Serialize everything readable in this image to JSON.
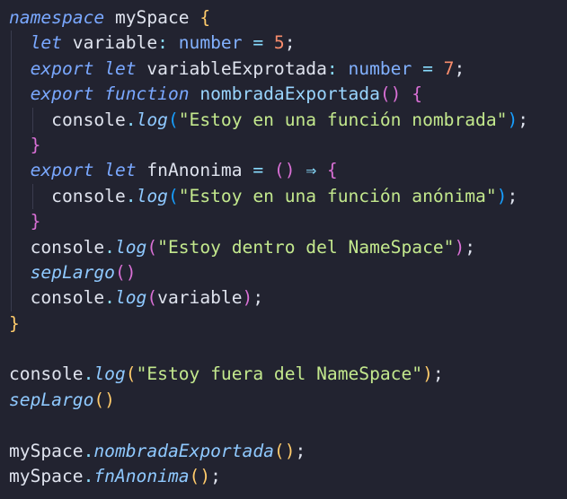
{
  "editor": {
    "lines": [
      [
        {
          "t": "namespace",
          "c": "t-kw"
        },
        {
          "t": " mySpace ",
          "c": "t-plain"
        },
        {
          "t": "{",
          "c": "t-b1"
        }
      ],
      [
        {
          "t": "  ",
          "c": "t-plain"
        },
        {
          "t": "let",
          "c": "t-kw"
        },
        {
          "t": " variable",
          "c": "t-plain"
        },
        {
          "t": ":",
          "c": "t-op"
        },
        {
          "t": " ",
          "c": "t-plain"
        },
        {
          "t": "number",
          "c": "t-type"
        },
        {
          "t": " ",
          "c": "t-plain"
        },
        {
          "t": "=",
          "c": "t-op"
        },
        {
          "t": " ",
          "c": "t-plain"
        },
        {
          "t": "5",
          "c": "t-num"
        },
        {
          "t": ";",
          "c": "t-plain"
        }
      ],
      [
        {
          "t": "  ",
          "c": "t-plain"
        },
        {
          "t": "export",
          "c": "t-kw"
        },
        {
          "t": " ",
          "c": "t-plain"
        },
        {
          "t": "let",
          "c": "t-kw"
        },
        {
          "t": " variableExprotada",
          "c": "t-plain"
        },
        {
          "t": ":",
          "c": "t-op"
        },
        {
          "t": " ",
          "c": "t-plain"
        },
        {
          "t": "number",
          "c": "t-type"
        },
        {
          "t": " ",
          "c": "t-plain"
        },
        {
          "t": "=",
          "c": "t-op"
        },
        {
          "t": " ",
          "c": "t-plain"
        },
        {
          "t": "7",
          "c": "t-num"
        },
        {
          "t": ";",
          "c": "t-plain"
        }
      ],
      [
        {
          "t": "  ",
          "c": "t-plain"
        },
        {
          "t": "export",
          "c": "t-kw"
        },
        {
          "t": " ",
          "c": "t-plain"
        },
        {
          "t": "function",
          "c": "t-kw"
        },
        {
          "t": " ",
          "c": "t-plain"
        },
        {
          "t": "nombradaExportada",
          "c": "t-fnname"
        },
        {
          "t": "()",
          "c": "t-b2"
        },
        {
          "t": " ",
          "c": "t-plain"
        },
        {
          "t": "{",
          "c": "t-b2"
        }
      ],
      [
        {
          "t": "    console",
          "c": "t-plain"
        },
        {
          "t": ".",
          "c": "t-op"
        },
        {
          "t": "log",
          "c": "t-fn-it"
        },
        {
          "t": "(",
          "c": "t-b3"
        },
        {
          "t": "\"Estoy en una función nombrada\"",
          "c": "t-str"
        },
        {
          "t": ")",
          "c": "t-b3"
        },
        {
          "t": ";",
          "c": "t-plain"
        }
      ],
      [
        {
          "t": "  ",
          "c": "t-plain"
        },
        {
          "t": "}",
          "c": "t-b2"
        }
      ],
      [
        {
          "t": "  ",
          "c": "t-plain"
        },
        {
          "t": "export",
          "c": "t-kw"
        },
        {
          "t": " ",
          "c": "t-plain"
        },
        {
          "t": "let",
          "c": "t-kw"
        },
        {
          "t": " fnAnonima ",
          "c": "t-plain"
        },
        {
          "t": "=",
          "c": "t-op"
        },
        {
          "t": " ",
          "c": "t-plain"
        },
        {
          "t": "()",
          "c": "t-b2"
        },
        {
          "t": " ",
          "c": "t-plain"
        },
        {
          "t": "⇒",
          "c": "t-op"
        },
        {
          "t": " ",
          "c": "t-plain"
        },
        {
          "t": "{",
          "c": "t-b2"
        }
      ],
      [
        {
          "t": "    console",
          "c": "t-plain"
        },
        {
          "t": ".",
          "c": "t-op"
        },
        {
          "t": "log",
          "c": "t-fn-it"
        },
        {
          "t": "(",
          "c": "t-b3"
        },
        {
          "t": "\"Estoy en una función anónima\"",
          "c": "t-str"
        },
        {
          "t": ")",
          "c": "t-b3"
        },
        {
          "t": ";",
          "c": "t-plain"
        }
      ],
      [
        {
          "t": "  ",
          "c": "t-plain"
        },
        {
          "t": "}",
          "c": "t-b2"
        }
      ],
      [
        {
          "t": "  console",
          "c": "t-plain"
        },
        {
          "t": ".",
          "c": "t-op"
        },
        {
          "t": "log",
          "c": "t-fn-it"
        },
        {
          "t": "(",
          "c": "t-b2"
        },
        {
          "t": "\"Estoy dentro del NameSpace\"",
          "c": "t-str"
        },
        {
          "t": ")",
          "c": "t-b2"
        },
        {
          "t": ";",
          "c": "t-plain"
        }
      ],
      [
        {
          "t": "  ",
          "c": "t-plain"
        },
        {
          "t": "sepLargo",
          "c": "t-fn-it"
        },
        {
          "t": "()",
          "c": "t-b2"
        }
      ],
      [
        {
          "t": "  console",
          "c": "t-plain"
        },
        {
          "t": ".",
          "c": "t-op"
        },
        {
          "t": "log",
          "c": "t-fn-it"
        },
        {
          "t": "(",
          "c": "t-b2"
        },
        {
          "t": "variable",
          "c": "t-plain"
        },
        {
          "t": ")",
          "c": "t-b2"
        },
        {
          "t": ";",
          "c": "t-plain"
        }
      ],
      [
        {
          "t": "}",
          "c": "t-b1"
        }
      ],
      [],
      [
        {
          "t": "console",
          "c": "t-plain"
        },
        {
          "t": ".",
          "c": "t-op"
        },
        {
          "t": "log",
          "c": "t-fn-it"
        },
        {
          "t": "(",
          "c": "t-b1"
        },
        {
          "t": "\"Estoy fuera del NameSpace\"",
          "c": "t-str"
        },
        {
          "t": ")",
          "c": "t-b1"
        },
        {
          "t": ";",
          "c": "t-plain"
        }
      ],
      [
        {
          "t": "sepLargo",
          "c": "t-fn-it"
        },
        {
          "t": "()",
          "c": "t-b1"
        }
      ],
      [],
      [
        {
          "t": "mySpace",
          "c": "t-plain"
        },
        {
          "t": ".",
          "c": "t-op"
        },
        {
          "t": "nombradaExportada",
          "c": "t-fn-it"
        },
        {
          "t": "()",
          "c": "t-b1"
        },
        {
          "t": ";",
          "c": "t-plain"
        }
      ],
      [
        {
          "t": "mySpace",
          "c": "t-plain"
        },
        {
          "t": ".",
          "c": "t-op"
        },
        {
          "t": "fnAnonima",
          "c": "t-fn-it"
        },
        {
          "t": "()",
          "c": "t-b1"
        },
        {
          "t": ";",
          "c": "t-plain"
        }
      ]
    ]
  },
  "colors": {
    "background": "#222330",
    "keyword": "#7aa8ff",
    "string": "#c3e88d",
    "number": "#f78c6c",
    "bracket_level1": "#ffcb6b",
    "bracket_level2": "#da70d6",
    "bracket_level3": "#179fff"
  }
}
